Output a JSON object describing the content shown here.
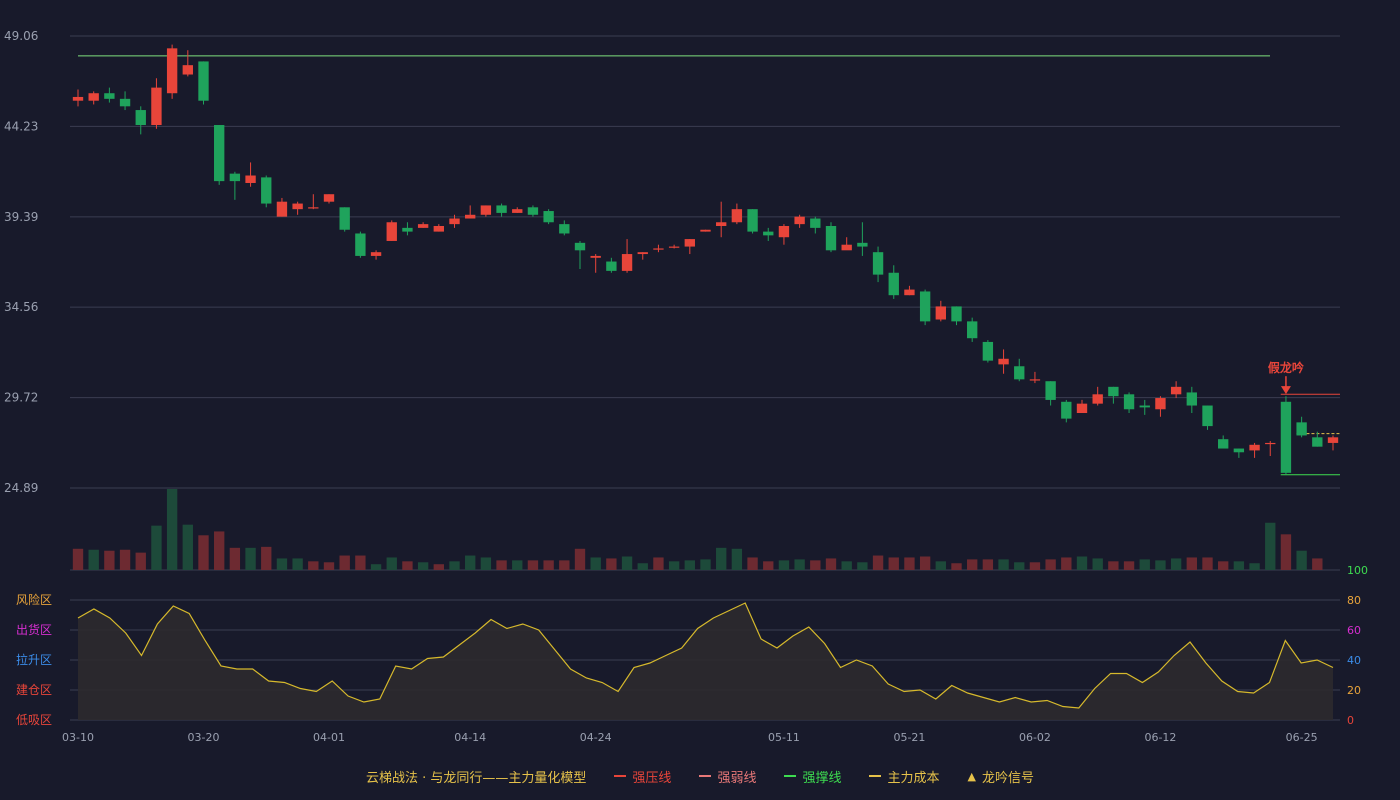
{
  "chart_data": {
    "type": "candlestick",
    "dates": [
      "03-10",
      "03-11",
      "03-12",
      "03-13",
      "03-14",
      "03-17",
      "03-18",
      "03-19",
      "03-20",
      "03-21",
      "03-24",
      "03-25",
      "03-26",
      "03-27",
      "03-28",
      "03-31",
      "04-01",
      "04-02",
      "04-03",
      "04-04",
      "04-07",
      "04-08",
      "04-09",
      "04-10",
      "04-11",
      "04-14",
      "04-15",
      "04-16",
      "04-17",
      "04-18",
      "04-21",
      "04-22",
      "04-23",
      "04-24",
      "04-25",
      "04-28",
      "04-29",
      "04-30",
      "05-01",
      "05-02",
      "05-05",
      "05-06",
      "05-07",
      "05-08",
      "05-09",
      "05-11",
      "05-12",
      "05-13",
      "05-14",
      "05-15",
      "05-16",
      "05-19",
      "05-20",
      "05-21",
      "05-22",
      "05-23",
      "05-26",
      "05-27",
      "05-28",
      "05-29",
      "05-30",
      "06-02",
      "06-03",
      "06-04",
      "06-05",
      "06-06",
      "06-09",
      "06-10",
      "06-11",
      "06-12",
      "06-13",
      "06-16",
      "06-17",
      "06-18",
      "06-19",
      "06-20",
      "06-23",
      "06-24",
      "06-25",
      "06-26",
      "06-27",
      "06-30",
      "07-01",
      "07-02",
      "07-03",
      "07-04",
      "07-07"
    ],
    "candles": [
      [
        45.6,
        45.8,
        45.3,
        46.2
      ],
      [
        45.6,
        46.0,
        45.4,
        46.1
      ],
      [
        46.0,
        45.7,
        45.5,
        46.3
      ],
      [
        45.7,
        45.3,
        45.1,
        46.1
      ],
      [
        45.1,
        44.3,
        43.8,
        45.3
      ],
      [
        44.3,
        46.3,
        44.1,
        46.8
      ],
      [
        46.0,
        48.4,
        45.7,
        48.6
      ],
      [
        47.0,
        47.5,
        46.9,
        48.3
      ],
      [
        47.7,
        45.6,
        45.4,
        47.7
      ],
      [
        44.3,
        41.3,
        41.1,
        44.3
      ],
      [
        41.7,
        41.3,
        40.3,
        41.8
      ],
      [
        41.2,
        41.6,
        41.0,
        42.3
      ],
      [
        41.5,
        40.1,
        39.9,
        41.6
      ],
      [
        39.4,
        40.2,
        39.4,
        40.4
      ],
      [
        39.8,
        40.1,
        39.5,
        40.2
      ],
      [
        39.9,
        39.9,
        39.8,
        40.6
      ],
      [
        40.2,
        40.6,
        40.1,
        40.6
      ],
      [
        39.9,
        38.7,
        38.6,
        39.9
      ],
      [
        38.5,
        37.3,
        37.2,
        38.6
      ],
      [
        37.3,
        37.5,
        37.1,
        37.6
      ],
      [
        38.1,
        39.1,
        38.1,
        39.2
      ],
      [
        38.8,
        38.6,
        38.4,
        39.1
      ],
      [
        38.8,
        39.0,
        38.8,
        39.1
      ],
      [
        38.6,
        38.9,
        38.6,
        39.0
      ],
      [
        39.0,
        39.3,
        38.8,
        39.5
      ],
      [
        39.3,
        39.5,
        39.4,
        40.0
      ],
      [
        39.5,
        40.0,
        39.4,
        40.0
      ],
      [
        40.0,
        39.6,
        39.4,
        40.1
      ],
      [
        39.6,
        39.8,
        39.6,
        39.9
      ],
      [
        39.9,
        39.5,
        39.4,
        40.0
      ],
      [
        39.7,
        39.1,
        39.0,
        39.8
      ],
      [
        39.0,
        38.5,
        38.4,
        39.2
      ],
      [
        38.0,
        37.6,
        36.6,
        38.1
      ],
      [
        37.2,
        37.3,
        36.4,
        37.4
      ],
      [
        37.0,
        36.5,
        36.4,
        37.2
      ],
      [
        36.5,
        37.4,
        36.4,
        38.2
      ],
      [
        37.4,
        37.5,
        37.1,
        37.5
      ],
      [
        37.7,
        37.7,
        37.5,
        37.9
      ],
      [
        37.8,
        37.8,
        37.7,
        37.9
      ],
      [
        37.8,
        38.2,
        37.4,
        38.2
      ],
      [
        38.6,
        38.7,
        38.6,
        38.7
      ],
      [
        38.9,
        39.1,
        38.3,
        40.2
      ],
      [
        39.1,
        39.8,
        39.0,
        40.1
      ],
      [
        39.8,
        38.6,
        38.5,
        39.8
      ],
      [
        38.6,
        38.4,
        38.1,
        38.8
      ],
      [
        38.3,
        38.9,
        37.9,
        39.0
      ],
      [
        39.0,
        39.4,
        38.8,
        39.5
      ],
      [
        39.3,
        38.8,
        38.5,
        39.4
      ],
      [
        38.9,
        37.6,
        37.5,
        39.1
      ],
      [
        37.6,
        37.9,
        37.7,
        38.3
      ],
      [
        38.0,
        37.8,
        37.3,
        39.1
      ],
      [
        37.5,
        36.3,
        35.9,
        37.8
      ],
      [
        36.4,
        35.2,
        35.0,
        36.8
      ],
      [
        35.2,
        35.5,
        35.2,
        35.7
      ],
      [
        35.4,
        33.8,
        33.6,
        35.5
      ],
      [
        33.9,
        34.6,
        33.8,
        34.9
      ],
      [
        34.6,
        33.8,
        33.6,
        34.6
      ],
      [
        33.8,
        32.9,
        32.7,
        34.0
      ],
      [
        32.7,
        31.7,
        31.6,
        32.8
      ],
      [
        31.5,
        31.8,
        31.0,
        32.3
      ],
      [
        31.4,
        30.7,
        30.6,
        31.8
      ],
      [
        30.7,
        30.7,
        30.5,
        31.1
      ],
      [
        30.6,
        29.6,
        29.3,
        30.6
      ],
      [
        29.5,
        28.6,
        28.4,
        29.6
      ],
      [
        28.9,
        29.4,
        28.9,
        29.6
      ],
      [
        29.4,
        29.9,
        29.3,
        30.3
      ],
      [
        30.3,
        29.8,
        29.4,
        30.3
      ],
      [
        29.9,
        29.1,
        28.9,
        30.0
      ],
      [
        29.3,
        29.2,
        28.8,
        29.6
      ],
      [
        29.1,
        29.7,
        28.7,
        29.8
      ],
      [
        29.9,
        30.3,
        29.7,
        30.6
      ],
      [
        30.0,
        29.3,
        28.9,
        30.3
      ],
      [
        29.3,
        28.2,
        28.0,
        29.3
      ],
      [
        27.5,
        27.0,
        27.2,
        27.7
      ],
      [
        27.0,
        26.8,
        26.5,
        27.0
      ],
      [
        26.9,
        27.2,
        26.5,
        27.3
      ],
      [
        27.3,
        27.3,
        26.6,
        27.4
      ],
      [
        29.5,
        25.7,
        25.6,
        29.8
      ],
      [
        28.4,
        27.7,
        27.6,
        28.7
      ],
      [
        27.6,
        27.1,
        27.1,
        27.9
      ],
      [
        27.3,
        27.6,
        26.9,
        27.7
      ]
    ],
    "volumes": [
      {
        "v": 1.1,
        "up": true
      },
      {
        "v": 1.05,
        "up": false
      },
      {
        "v": 1.0,
        "up": true
      },
      {
        "v": 1.05,
        "up": true
      },
      {
        "v": 0.9,
        "up": true
      },
      {
        "v": 2.3,
        "up": false
      },
      {
        "v": 4.2,
        "up": false
      },
      {
        "v": 2.35,
        "up": false
      },
      {
        "v": 1.8,
        "up": true
      },
      {
        "v": 2.0,
        "up": true
      },
      {
        "v": 1.15,
        "up": true
      },
      {
        "v": 1.15,
        "up": false
      },
      {
        "v": 1.2,
        "up": true
      },
      {
        "v": 0.6,
        "up": false
      },
      {
        "v": 0.6,
        "up": false
      },
      {
        "v": 0.45,
        "up": true
      },
      {
        "v": 0.4,
        "up": true
      },
      {
        "v": 0.75,
        "up": true
      },
      {
        "v": 0.75,
        "up": true
      },
      {
        "v": 0.3,
        "up": false
      },
      {
        "v": 0.65,
        "up": false
      },
      {
        "v": 0.45,
        "up": true
      },
      {
        "v": 0.4,
        "up": false
      },
      {
        "v": 0.3,
        "up": true
      },
      {
        "v": 0.45,
        "up": false
      },
      {
        "v": 0.75,
        "up": false
      },
      {
        "v": 0.65,
        "up": false
      },
      {
        "v": 0.5,
        "up": true
      },
      {
        "v": 0.5,
        "up": false
      },
      {
        "v": 0.5,
        "up": true
      },
      {
        "v": 0.5,
        "up": true
      },
      {
        "v": 0.5,
        "up": true
      },
      {
        "v": 1.1,
        "up": true
      },
      {
        "v": 0.65,
        "up": false
      },
      {
        "v": 0.6,
        "up": true
      },
      {
        "v": 0.7,
        "up": false
      },
      {
        "v": 0.35,
        "up": false
      },
      {
        "v": 0.65,
        "up": true
      },
      {
        "v": 0.45,
        "up": false
      },
      {
        "v": 0.5,
        "up": false
      },
      {
        "v": 0.55,
        "up": false
      },
      {
        "v": 1.15,
        "up": false
      },
      {
        "v": 1.1,
        "up": false
      },
      {
        "v": 0.65,
        "up": true
      },
      {
        "v": 0.45,
        "up": true
      },
      {
        "v": 0.5,
        "up": false
      },
      {
        "v": 0.55,
        "up": false
      },
      {
        "v": 0.5,
        "up": true
      },
      {
        "v": 0.6,
        "up": true
      },
      {
        "v": 0.45,
        "up": false
      },
      {
        "v": 0.4,
        "up": false
      },
      {
        "v": 0.75,
        "up": true
      },
      {
        "v": 0.65,
        "up": true
      },
      {
        "v": 0.65,
        "up": true
      },
      {
        "v": 0.7,
        "up": true
      },
      {
        "v": 0.45,
        "up": false
      },
      {
        "v": 0.35,
        "up": true
      },
      {
        "v": 0.55,
        "up": true
      },
      {
        "v": 0.55,
        "up": true
      },
      {
        "v": 0.55,
        "up": false
      },
      {
        "v": 0.4,
        "up": false
      },
      {
        "v": 0.4,
        "up": true
      },
      {
        "v": 0.55,
        "up": true
      },
      {
        "v": 0.65,
        "up": true
      },
      {
        "v": 0.7,
        "up": false
      },
      {
        "v": 0.6,
        "up": false
      },
      {
        "v": 0.45,
        "up": true
      },
      {
        "v": 0.45,
        "up": true
      },
      {
        "v": 0.55,
        "up": false
      },
      {
        "v": 0.5,
        "up": false
      },
      {
        "v": 0.6,
        "up": false
      },
      {
        "v": 0.65,
        "up": true
      },
      {
        "v": 0.65,
        "up": true
      },
      {
        "v": 0.45,
        "up": true
      },
      {
        "v": 0.45,
        "up": false
      },
      {
        "v": 0.35,
        "up": false
      },
      {
        "v": 2.45,
        "up": false
      },
      {
        "v": 1.85,
        "up": true
      },
      {
        "v": 1.0,
        "up": false
      },
      {
        "v": 0.6,
        "up": true
      }
    ],
    "oscillator": [
      68,
      74,
      68,
      58,
      43,
      64,
      76,
      71,
      53,
      36,
      34,
      34,
      26,
      25,
      21,
      19,
      26,
      16,
      12,
      14,
      36,
      34,
      41,
      42,
      50,
      58,
      67,
      61,
      64,
      60,
      47,
      34,
      28,
      25,
      19,
      35,
      38,
      43,
      48,
      61,
      68,
      73,
      78,
      54,
      48,
      56,
      62,
      51,
      35,
      40,
      36,
      24,
      19,
      20,
      14,
      23,
      18,
      15,
      12,
      15,
      12,
      13,
      9,
      8,
      21,
      31,
      31,
      25,
      32,
      43,
      52,
      38,
      26,
      19,
      18,
      25,
      53,
      38,
      40,
      35
    ],
    "y_ticks": [
      "49.06",
      "44.23",
      "39.39",
      "34.56",
      "29.72",
      "24.89"
    ],
    "x_ticks": [
      "03-10",
      "03-20",
      "04-01",
      "04-14",
      "04-24",
      "05-11",
      "05-21",
      "06-02",
      "06-12",
      "06-25"
    ],
    "osc_right_ticks": [
      {
        "label": "100",
        "color": "#3ddc50"
      },
      {
        "label": "80",
        "color": "#e8a33a"
      },
      {
        "label": "60",
        "color": "#d62ed0"
      },
      {
        "label": "40",
        "color": "#3b8ce8"
      },
      {
        "label": "20",
        "color": "#e8a33a"
      },
      {
        "label": "0",
        "color": "#e8453a"
      }
    ],
    "zones": [
      {
        "label": "风险区",
        "color": "#e8a33a"
      },
      {
        "label": "出货区",
        "color": "#d62ed0"
      },
      {
        "label": "拉升区",
        "color": "#3b8ce8"
      },
      {
        "label": "建仓区",
        "color": "#e8453a"
      },
      {
        "label": "低吸区",
        "color": "#e8453a"
      }
    ],
    "resistance_level": 48.0,
    "pressure_level": 29.9,
    "support_level": 25.6,
    "cost_level": 27.8,
    "signal_label": "假龙吟",
    "colors": {
      "up": "#e8453a",
      "down": "#1fa35c",
      "vol_up": "#6d2a31",
      "vol_down": "#1d4a3a",
      "grid": "#3a3d52",
      "axis_text": "#9aa0b0",
      "resistance": "#7ee07e",
      "support": "#3ddc50",
      "pressure": "#e8453a",
      "cost": "#e6c24a",
      "osc_line": "#d6b92c",
      "osc_fill": "#2c2a2d",
      "signal": "#e8453a"
    }
  },
  "legend": {
    "title": "云梯战法 · 与龙同行——主力量化模型",
    "items": [
      {
        "label": "强压线",
        "color": "#e8453a",
        "style": "solid"
      },
      {
        "label": "强弱线",
        "color": "#e87878",
        "style": "dashed"
      },
      {
        "label": "强撑线",
        "color": "#3ddc50",
        "style": "solid"
      },
      {
        "label": "主力成本",
        "color": "#e6c24a",
        "style": "dashed"
      }
    ],
    "signal": {
      "label": "龙吟信号",
      "color": "#e6c24a"
    }
  }
}
